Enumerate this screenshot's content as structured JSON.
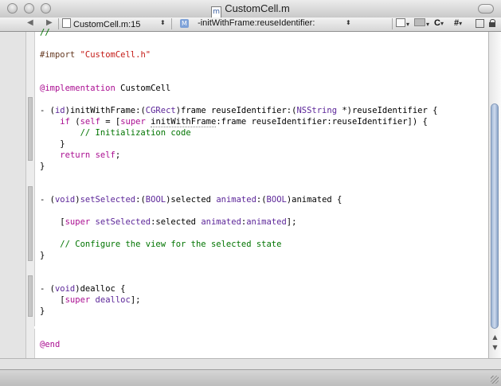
{
  "window": {
    "title": "CustomCell.m",
    "file_icon_letter": "m"
  },
  "navbar": {
    "back_arrow": "◀",
    "forward_arrow": "▶",
    "file_menu": "CustomCell.m:15",
    "stepper": "⬍",
    "symbol_badge": "M",
    "symbol_menu": "-initWithFrame:reuseIdentifier:",
    "c_menu": "C",
    "hash_menu": "#",
    "caret": "▾"
  },
  "code_lines": [
    {
      "text": "//"
    },
    {
      "text": ""
    },
    {
      "text": "#import \"CustomCell.h\""
    },
    {
      "text": ""
    },
    {
      "text": ""
    },
    {
      "text": "@implementation CustomCell"
    },
    {
      "text": ""
    },
    {
      "text": "- (id)initWithFrame:(CGRect)frame reuseIdentifier:(NSString *)reuseIdentifier {"
    },
    {
      "text": "    if (self = [super initWithFrame:frame reuseIdentifier:reuseIdentifier]) {"
    },
    {
      "text": "        // Initialization code"
    },
    {
      "text": "    }"
    },
    {
      "text": "    return self;"
    },
    {
      "text": "}"
    },
    {
      "text": ""
    },
    {
      "text": ""
    },
    {
      "text": "- (void)setSelected:(BOOL)selected animated:(BOOL)animated {"
    },
    {
      "text": ""
    },
    {
      "text": "    [super setSelected:selected animated:animated];"
    },
    {
      "text": ""
    },
    {
      "text": "    // Configure the view for the selected state"
    },
    {
      "text": "}"
    },
    {
      "text": ""
    },
    {
      "text": ""
    },
    {
      "text": "- (void)dealloc {"
    },
    {
      "text": "    [super dealloc];"
    },
    {
      "text": "}"
    },
    {
      "text": ""
    },
    {
      "text": ""
    },
    {
      "text": "@end"
    }
  ],
  "colors": {
    "keyword": "#aa0d91",
    "string": "#c41a16",
    "comment": "#007400",
    "type": "#5c2699",
    "preprocessor": "#643820"
  }
}
